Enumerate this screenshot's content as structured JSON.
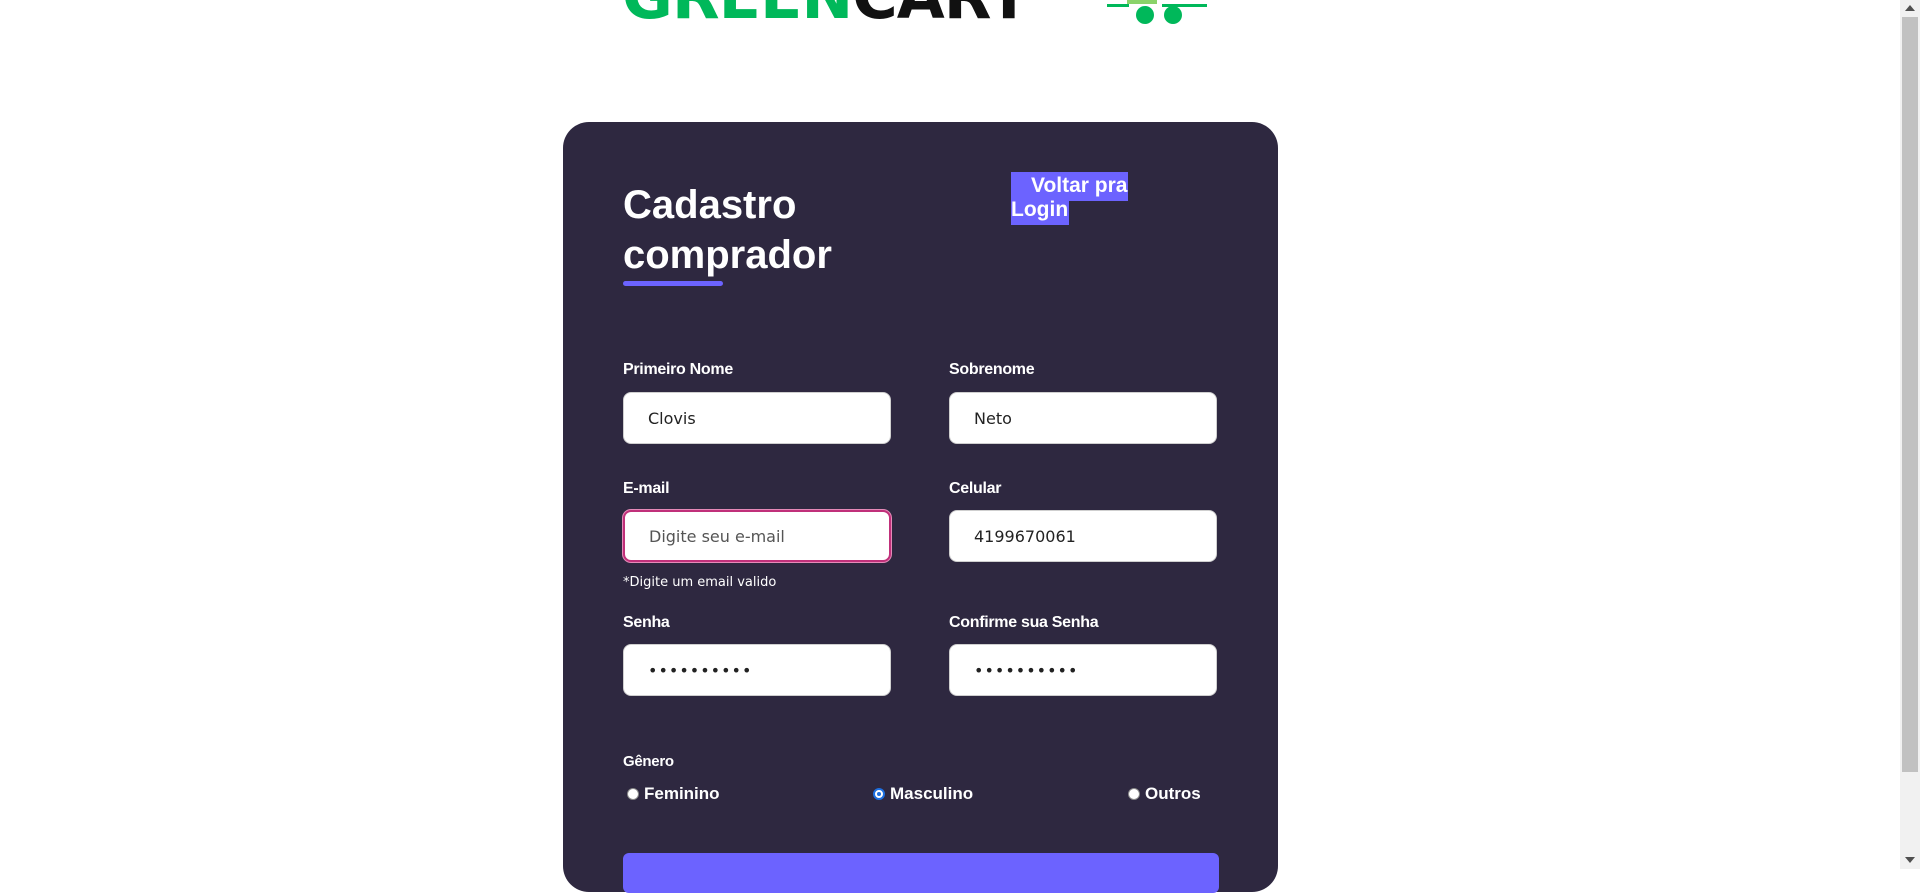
{
  "logo": {
    "part_green": "GREEN",
    "part_black": "CART",
    "icon": "shopping-cart-icon",
    "green_color": "#00b85a"
  },
  "form": {
    "title": "Cadastro comprador",
    "back_button": {
      "line1": "Voltar pra",
      "line2": "Login"
    },
    "fields": {
      "first_name": {
        "label": "Primeiro Nome",
        "value": "Clovis"
      },
      "last_name": {
        "label": "Sobrenome",
        "value": "Neto"
      },
      "email": {
        "label": "E-mail",
        "value": "",
        "placeholder": "Digite seu e-mail",
        "hint": "*Digite um email valido"
      },
      "phone": {
        "label": "Celular",
        "value": "4199670061"
      },
      "password": {
        "label": "Senha",
        "value": "••••••••••"
      },
      "confirm_password": {
        "label": "Confirme sua Senha",
        "value": "••••••••••"
      }
    },
    "gender": {
      "label": "Gênero",
      "options": [
        "Feminino",
        "Masculino",
        "Outros"
      ],
      "selected": "Masculino"
    }
  },
  "colors": {
    "card_background": "#2e2840",
    "accent": "#6c63ff",
    "focus_border": "#c0307a",
    "page_background": "#ffffff"
  }
}
